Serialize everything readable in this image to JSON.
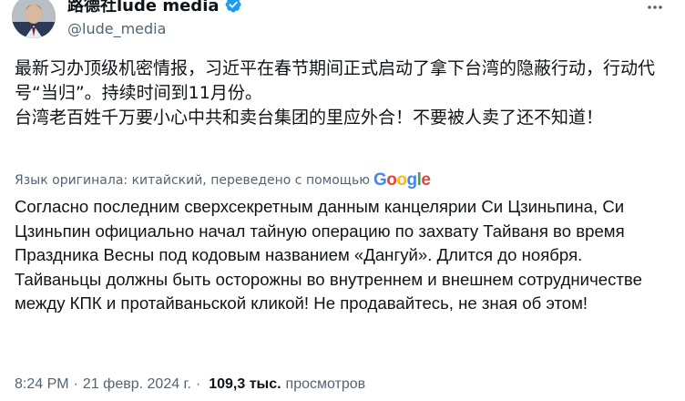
{
  "header": {
    "display_name": "路德社lude media",
    "handle": "@lude_media"
  },
  "original": {
    "paragraphs": [
      "最新习办顶级机密情报，习近平在春节期间正式启动了拿下台湾的隐蔽行动，行动代号“当归”。持续时间到11月份。",
      "台湾老百姓千万要小心中共和卖台集团的里应外合！不要被人卖了还不知道！"
    ]
  },
  "translation": {
    "note": "Язык оригинала: китайский, переведено с помощью",
    "provider": "Google",
    "paragraphs": [
      "Согласно последним сверхсекретным данным канцелярии Си Цзиньпина, Си Цзиньпин официально начал тайную операцию по захвату Тайваня во время Праздника Весны под кодовым названием «Дангуй». Длится до ноября.",
      "Тайваньцы должны быть осторожны во внутреннем и внешнем сотрудничестве между КПК и протайваньской кликой! Не продавайтесь, не зная об этом!"
    ]
  },
  "meta": {
    "time": "8:24 PM",
    "separator": "·",
    "date": "21 февр. 2024 г.",
    "views_count": "109,3 тыс.",
    "views_label": "просмотров"
  },
  "colors": {
    "text": "#0f1419",
    "secondary": "#536471",
    "verified": "#1d9bf0"
  },
  "icons": {
    "verified": "verified-badge-icon",
    "more": "more-horizontal-icon",
    "google": "google-logo"
  }
}
